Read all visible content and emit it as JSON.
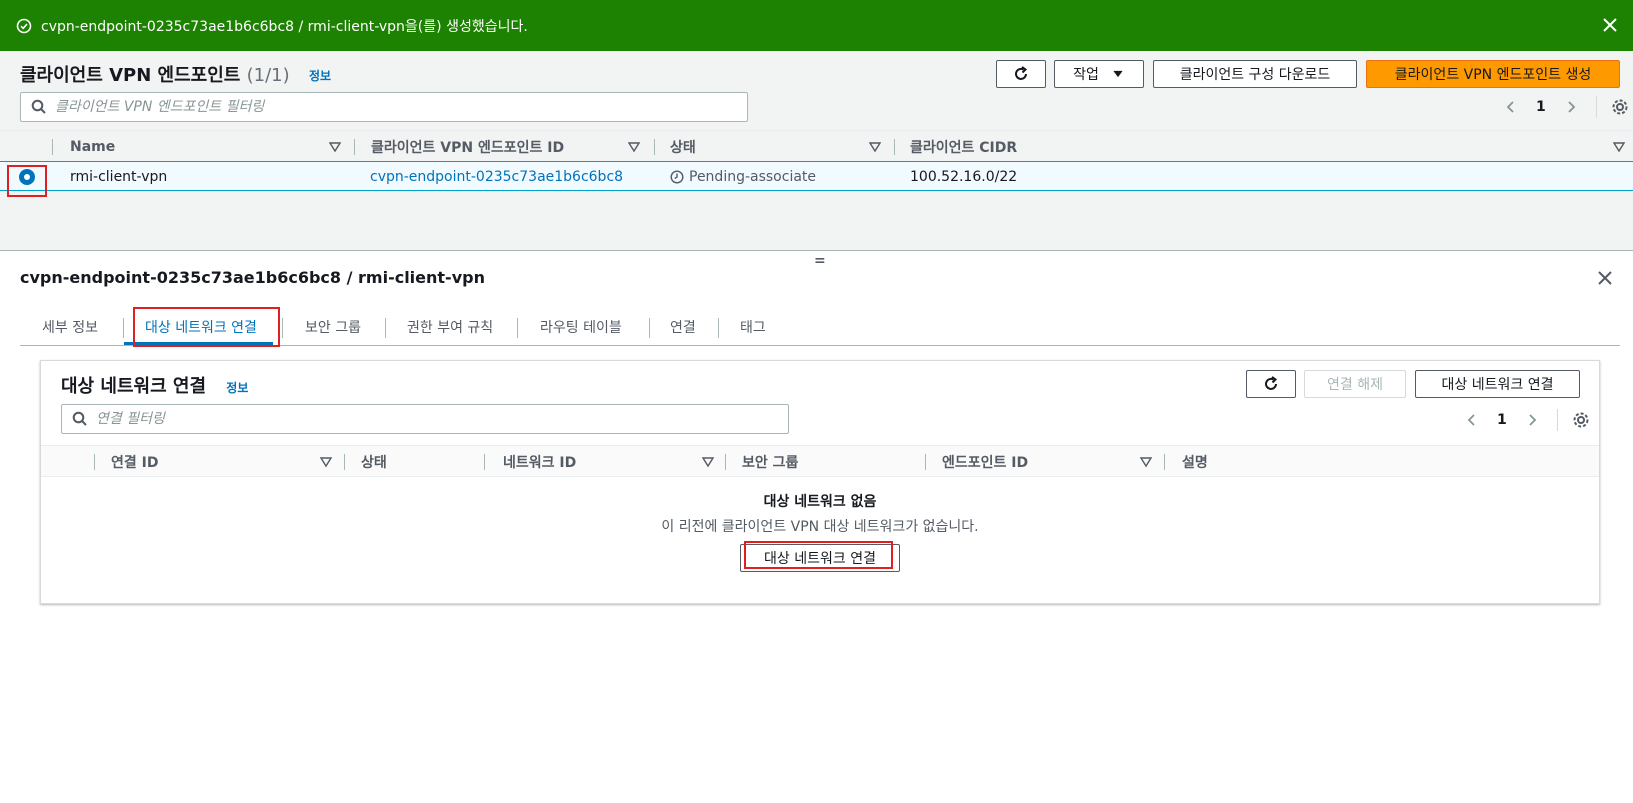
{
  "flash": {
    "message": "cvpn-endpoint-0235c73ae1b6c6bc8 / rmi-client-vpn을(를) 생성했습니다."
  },
  "header": {
    "title": "클라이언트 VPN 엔드포인트",
    "count": "(1/1)",
    "info": "정보",
    "actions_label": "작업",
    "download_label": "클라이언트 구성 다운로드",
    "create_label": "클라이언트 VPN 엔드포인트 생성",
    "search_placeholder": "클라이언트 VPN 엔드포인트 필터링",
    "page": "1"
  },
  "table": {
    "columns": [
      "Name",
      "클라이언트 VPN 엔드포인트 ID",
      "상태",
      "클라이언트 CIDR"
    ],
    "rows": [
      {
        "name": "rmi-client-vpn",
        "id": "cvpn-endpoint-0235c73ae1b6c6bc8",
        "status": "Pending-associate",
        "cidr": "100.52.16.0/22"
      }
    ]
  },
  "split_handle": "=",
  "detail": {
    "title": "cvpn-endpoint-0235c73ae1b6c6bc8 / rmi-client-vpn",
    "tabs": [
      "세부 정보",
      "대상 네트워크 연결",
      "보안 그룹",
      "권한 부여 규칙",
      "라우팅 테이블",
      "연결",
      "태그"
    ],
    "active_tab": "대상 네트워크 연결",
    "section": {
      "title": "대상 네트워크 연결",
      "info": "정보",
      "disassociate_label": "연결 해제",
      "associate_label": "대상 네트워크 연결",
      "search_placeholder": "연결 필터링",
      "page": "1",
      "columns": [
        "연결 ID",
        "상태",
        "네트워크 ID",
        "보안 그룹",
        "엔드포인트 ID",
        "설명"
      ],
      "empty_title": "대상 네트워크 없음",
      "empty_desc": "이 리전에 클라이언트 VPN 대상 네트워크가 없습니다.",
      "empty_button": "대상 네트워크 연결"
    }
  },
  "colors": {
    "success": "#1d8102",
    "primary": "#ff9900",
    "link": "#0073bb",
    "highlight": "#e02020"
  }
}
